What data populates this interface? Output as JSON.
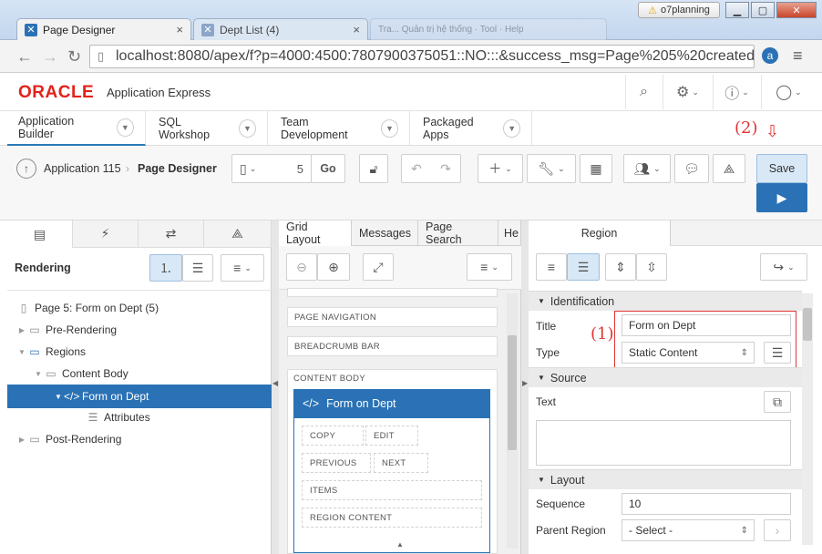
{
  "browser": {
    "tabs": [
      {
        "label": "Page Designer"
      },
      {
        "label": "Dept List (4)"
      },
      {
        "label": "Tra...  Quản trị hệ thống · Tool · Help"
      }
    ],
    "warning_label": "o7planning",
    "url": "localhost:8080/apex/f?p=4000:4500:7807900375051::NO:::&success_msg=Page%205%20created"
  },
  "header": {
    "brand": "ORACLE",
    "product": "Application Express"
  },
  "menu": {
    "items": [
      {
        "label": "Application Builder"
      },
      {
        "label": "SQL Workshop"
      },
      {
        "label": "Team Development"
      },
      {
        "label": "Packaged Apps"
      }
    ]
  },
  "toolbar": {
    "breadcrumb_app": "Application 115",
    "breadcrumb_page": "Page Designer",
    "page_number": "5",
    "go_label": "Go",
    "save_label": "Save"
  },
  "annotations": {
    "note1": "(1)",
    "note2": "(2)"
  },
  "left_panel": {
    "title": "Rendering",
    "tree": [
      {
        "label": "Page 5: Form on Dept (5)"
      },
      {
        "label": "Pre-Rendering"
      },
      {
        "label": "Regions"
      },
      {
        "label": "Content Body"
      },
      {
        "label": "Form on Dept"
      },
      {
        "label": "Attributes"
      },
      {
        "label": "Post-Rendering"
      }
    ]
  },
  "middle_panel": {
    "tabs": [
      {
        "label": "Grid Layout"
      },
      {
        "label": "Messages"
      },
      {
        "label": "Page Search"
      },
      {
        "label": "He"
      }
    ],
    "slots": [
      {
        "label": "PAGE NAVIGATION"
      },
      {
        "label": "BREADCRUMB BAR"
      },
      {
        "label": "CONTENT BODY"
      }
    ],
    "region_title": "Form on Dept",
    "region_slots": {
      "copy": "COPY",
      "edit": "EDIT",
      "previous": "PREVIOUS",
      "next": "NEXT",
      "items": "ITEMS",
      "region_content": "REGION CONTENT"
    }
  },
  "right_panel": {
    "tab": "Region",
    "sections": {
      "identification": "Identification",
      "source": "Source",
      "layout": "Layout"
    },
    "fields": {
      "title_label": "Title",
      "title_value": "Form on Dept",
      "type_label": "Type",
      "type_value": "Static Content",
      "text_label": "Text",
      "sequence_label": "Sequence",
      "sequence_value": "10",
      "parent_region_label": "Parent Region",
      "parent_region_value": "- Select -"
    }
  }
}
